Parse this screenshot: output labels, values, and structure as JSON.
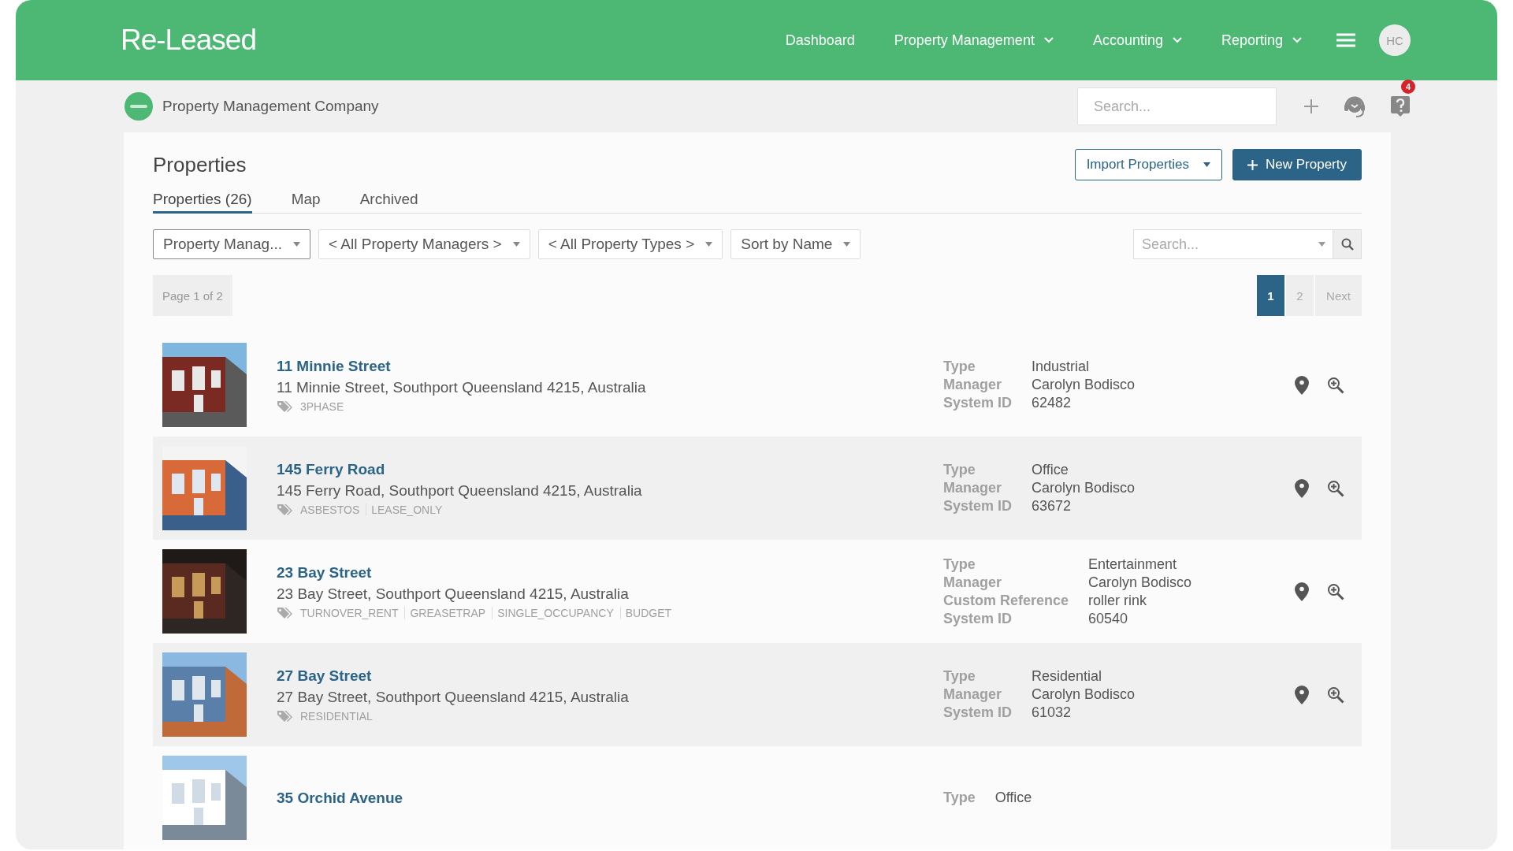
{
  "brand": {
    "logo": "Re-Leased"
  },
  "nav": [
    {
      "label": "Dashboard",
      "dropdown": false
    },
    {
      "label": "Property Management",
      "dropdown": true
    },
    {
      "label": "Accounting",
      "dropdown": true
    },
    {
      "label": "Reporting",
      "dropdown": true
    }
  ],
  "user": {
    "initials": "HC"
  },
  "company": {
    "name": "Property Management Company"
  },
  "top_search": {
    "placeholder": "Search..."
  },
  "notifications": {
    "count": "4"
  },
  "page": {
    "title": "Properties",
    "import_button": "Import Properties",
    "new_button": "New Property"
  },
  "tabs": [
    {
      "label": "Properties (26)",
      "selected": true
    },
    {
      "label": "Map",
      "selected": false
    },
    {
      "label": "Archived",
      "selected": false
    }
  ],
  "filters": [
    {
      "value": "Property Manag...",
      "focused": true
    },
    {
      "value": "< All Property Managers >",
      "focused": false
    },
    {
      "value": "< All Property Types >",
      "focused": false
    },
    {
      "value": "Sort by Name",
      "focused": false
    }
  ],
  "list_search": {
    "placeholder": "Search..."
  },
  "page_info": "Page 1 of 2",
  "pages": [
    {
      "label": "1",
      "selected": true
    },
    {
      "label": "2",
      "selected": false
    }
  ],
  "next_label": "Next",
  "properties": [
    {
      "name": "11 Minnie Street",
      "address": "11 Minnie Street, Southport Queensland 4215, Australia",
      "tags": [
        "3PHASE"
      ],
      "details": [
        {
          "label": "Type",
          "value": "Industrial"
        },
        {
          "label": "Manager",
          "value": "Carolyn Bodisco"
        },
        {
          "label": "System ID",
          "value": "62482"
        }
      ]
    },
    {
      "name": "145 Ferry Road",
      "address": "145 Ferry Road, Southport Queensland 4215, Australia",
      "tags": [
        "ASBESTOS",
        "LEASE_ONLY"
      ],
      "details": [
        {
          "label": "Type",
          "value": "Office"
        },
        {
          "label": "Manager",
          "value": "Carolyn Bodisco"
        },
        {
          "label": "System ID",
          "value": "63672"
        }
      ]
    },
    {
      "name": "23 Bay Street",
      "address": "23 Bay Street, Southport Queensland 4215, Australia",
      "tags": [
        "TURNOVER_RENT",
        "GREASETRAP",
        "SINGLE_OCCUPANCY",
        "BUDGET"
      ],
      "details": [
        {
          "label": "Type",
          "value": "Entertainment"
        },
        {
          "label": "Manager",
          "value": "Carolyn Bodisco"
        },
        {
          "label": "Custom Reference",
          "value": "roller rink"
        },
        {
          "label": "System ID",
          "value": "60540"
        }
      ]
    },
    {
      "name": "27 Bay Street",
      "address": "27 Bay Street, Southport Queensland 4215, Australia",
      "tags": [
        "RESIDENTIAL"
      ],
      "details": [
        {
          "label": "Type",
          "value": "Residential"
        },
        {
          "label": "Manager",
          "value": "Carolyn Bodisco"
        },
        {
          "label": "System ID",
          "value": "61032"
        }
      ]
    },
    {
      "name": "35 Orchid Avenue",
      "details": [
        {
          "label": "Type",
          "value": "Office"
        }
      ]
    }
  ]
}
